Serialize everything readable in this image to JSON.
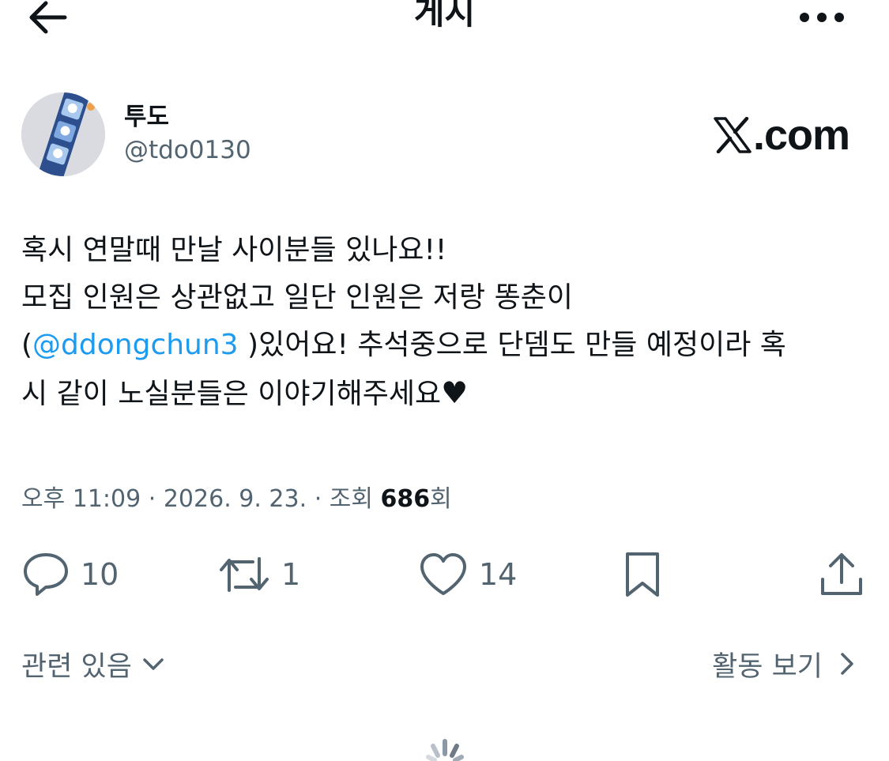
{
  "header": {
    "title": "게시",
    "back_icon": "arrow-left-icon",
    "more_icon": "more-horizontal-icon"
  },
  "author": {
    "display_name": "투도",
    "handle": "@tdo0130"
  },
  "brand": {
    "text": ".com",
    "logo_icon": "x-logo-icon"
  },
  "post": {
    "line1": "혹시 연말때 만날 사이분들 있나요!!",
    "line2": "모집 인원은 상관없고 일단 인원은 저랑 똥춘이",
    "line3_pre": "(",
    "mention": "@ddongchun3",
    "line3_post": " )있어요! 추석중으로 단뎀도 만들 예정이라 혹",
    "line4": "시 같이 노실분들은 이야기해주세요",
    "heart_glyph": "♥"
  },
  "meta": {
    "time": "오후 11:09",
    "separator": "·",
    "date": "2026. 9. 23.",
    "views_label": "조회",
    "views_count": "686",
    "views_suffix": "회"
  },
  "actions": {
    "replies": "10",
    "reposts": "1",
    "likes": "14"
  },
  "footer": {
    "related_label": "관련 있음",
    "activity_label": "활동 보기"
  },
  "colors": {
    "text": "#0f1419",
    "muted": "#536471",
    "link": "#1d9bf0"
  }
}
